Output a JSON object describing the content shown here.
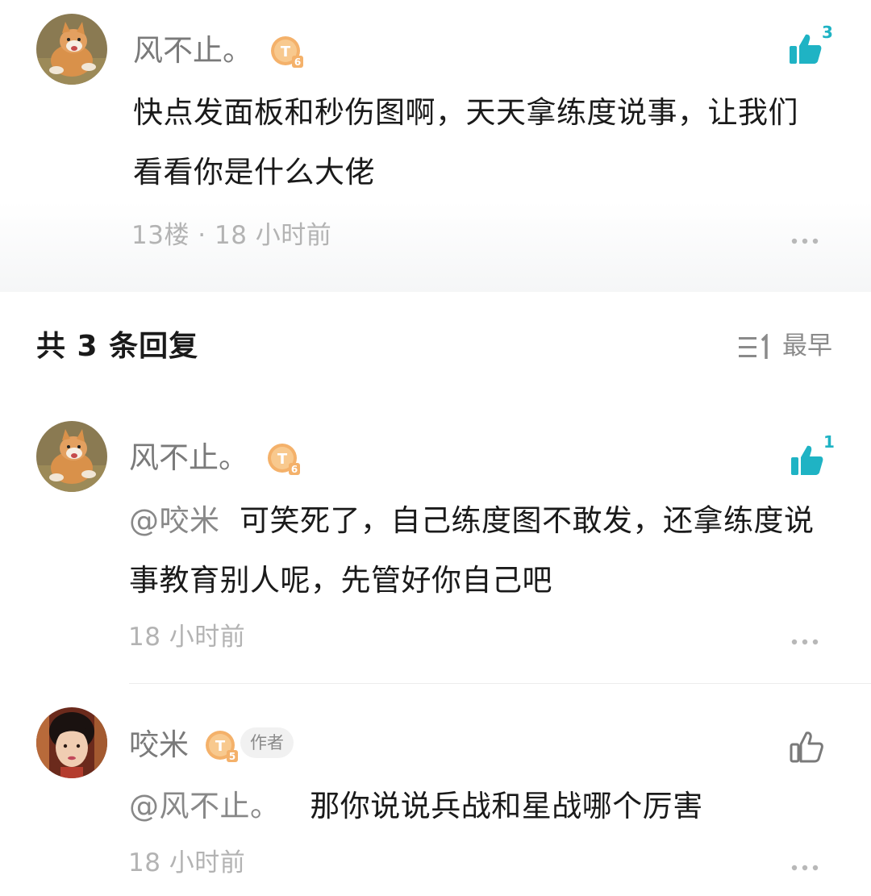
{
  "main_comment": {
    "username": "风不止。",
    "level": "6",
    "text_line1": "快点发面板和秒伤图啊，天天拿练度说事，让我们",
    "text_line2": "看看你是什么大佬",
    "floor_time": "13楼 · 18 小时前",
    "like_count": "3",
    "like_color": "#1fb3c4"
  },
  "replies_header": {
    "title": "共 3 条回复",
    "sort_label": "最早"
  },
  "replies": [
    {
      "username": "风不止。",
      "level": "6",
      "mention": "@咬米",
      "text_line1": "可笑死了，自己练度图不敢发，还拿练度说",
      "text_line2": "事教育别人呢，先管好你自己吧",
      "time": "18 小时前",
      "like_count": "1"
    },
    {
      "username": "咬米",
      "level": "5",
      "author_tag": "作者",
      "mention": "@风不止。",
      "text": "那你说说兵战和星战哪个厉害",
      "time": "18 小时前"
    }
  ]
}
